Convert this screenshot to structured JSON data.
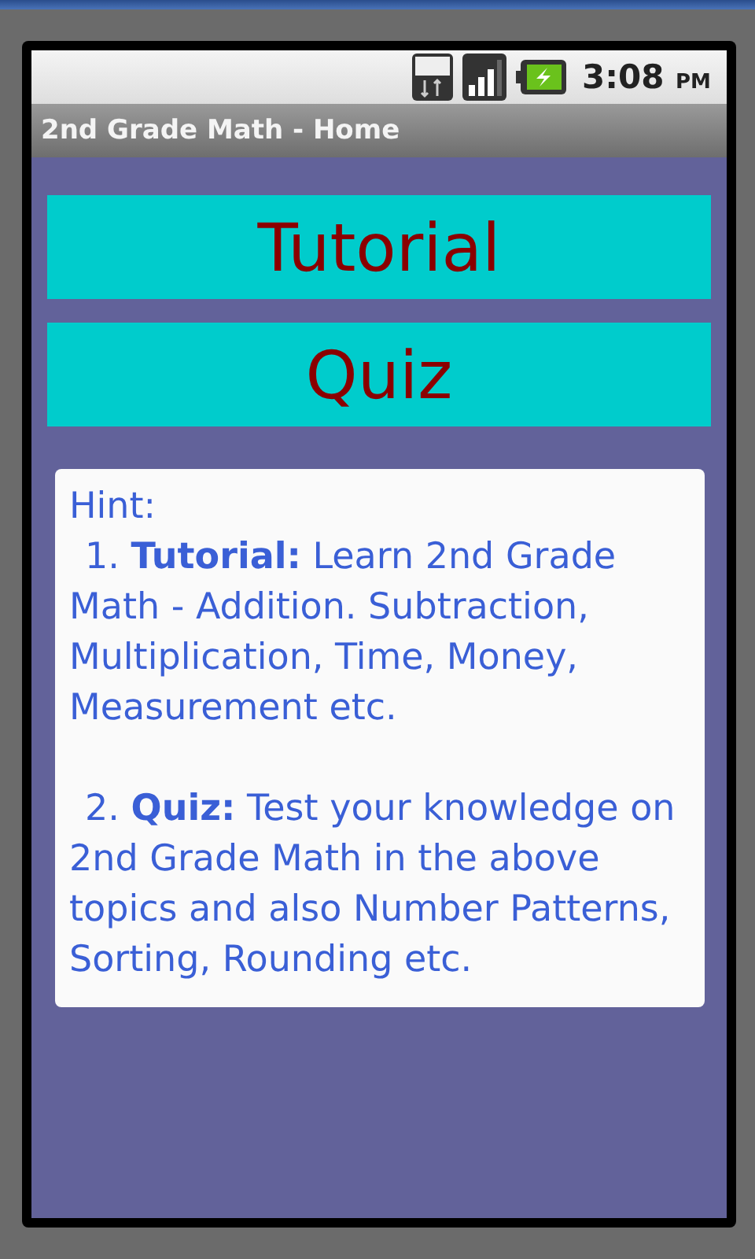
{
  "status_bar": {
    "time": "3:08",
    "ampm": "PM"
  },
  "window": {
    "title": "2nd Grade Math - Home"
  },
  "buttons": [
    {
      "label": "Tutorial"
    },
    {
      "label": "Quiz"
    }
  ],
  "hint": {
    "title": "Hint:",
    "items": [
      "1. **Tutorial:** Learn 2nd Grade Math - Addition. Subtraction, Multiplication, Time, Money, Measurement etc.",
      "2. **Quiz:** Test your knowledge on 2nd Grade Math in the above topics and also Number Patterns, Sorting, Rounding etc."
    ]
  }
}
